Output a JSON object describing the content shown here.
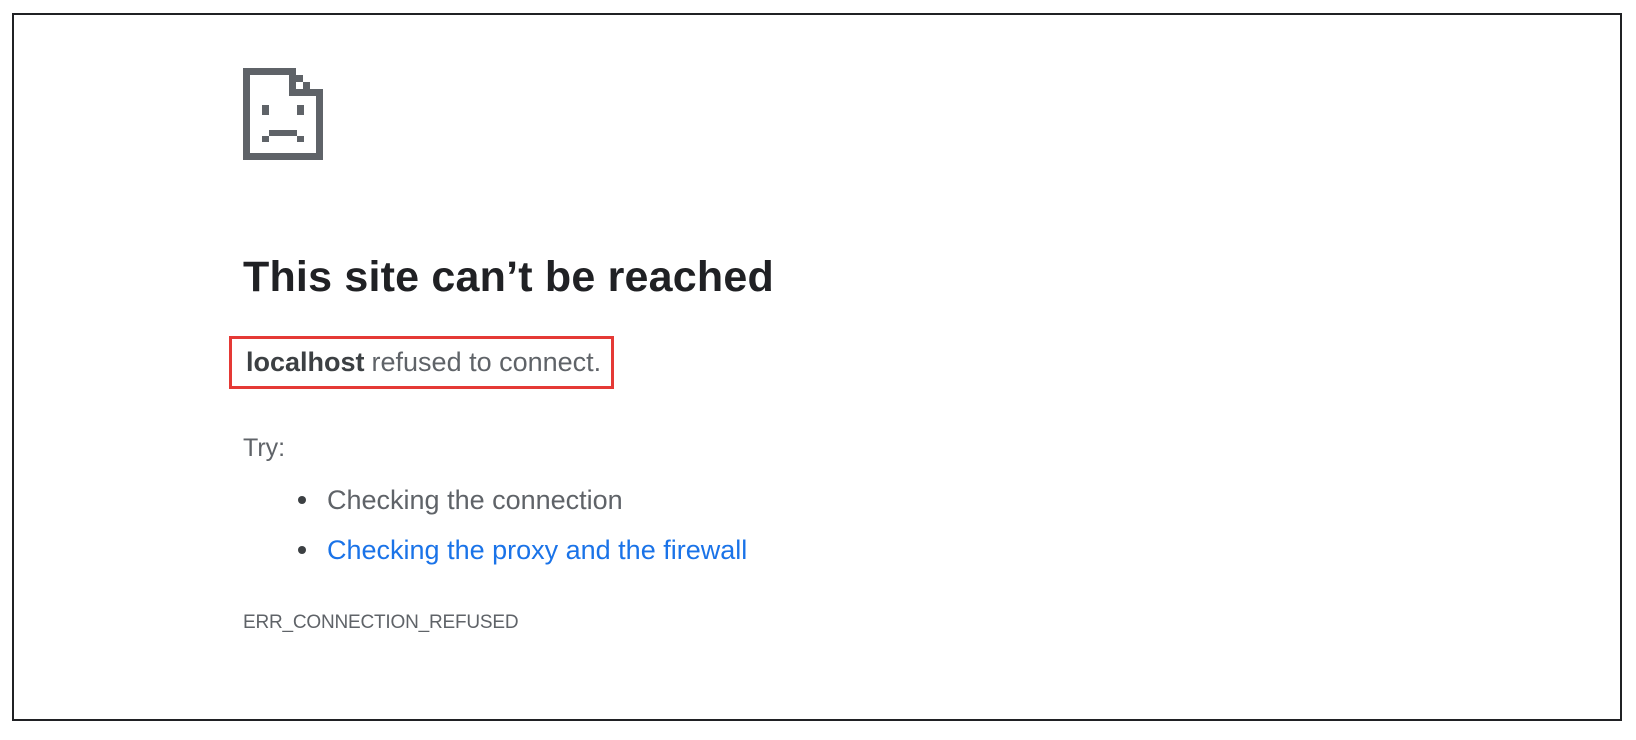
{
  "icon": {
    "name": "sad-page-icon",
    "color": "#5f6368"
  },
  "error": {
    "title": "This site can’t be reached",
    "host": "localhost",
    "message": "refused to connect.",
    "try_label": "Try:",
    "suggestions": [
      {
        "text": "Checking the connection",
        "is_link": false
      },
      {
        "text": "Checking the proxy and the firewall",
        "is_link": true
      }
    ],
    "code": "ERR_CONNECTION_REFUSED"
  },
  "colors": {
    "title": "#202124",
    "body_text": "#5f6368",
    "link": "#1a73e8",
    "highlight_border": "#e53935"
  }
}
